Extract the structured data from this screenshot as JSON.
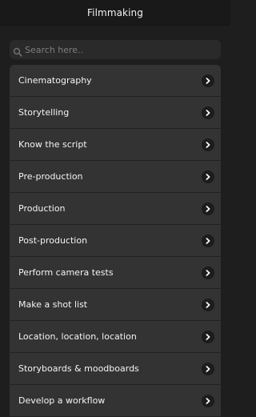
{
  "app_bar": {
    "title": "Filmmaking"
  },
  "search": {
    "placeholder": "Search here..",
    "value": "",
    "icon": "search-icon"
  },
  "list": {
    "item_icon": "chevron-right-icon",
    "items": [
      {
        "label": "Cinematography"
      },
      {
        "label": "Storytelling"
      },
      {
        "label": "Know the script"
      },
      {
        "label": "Pre-production"
      },
      {
        "label": "Production"
      },
      {
        "label": "Post-production"
      },
      {
        "label": "Perform camera tests"
      },
      {
        "label": "Make a shot list"
      },
      {
        "label": "Location, location, location"
      },
      {
        "label": "Storyboards & moodboards"
      },
      {
        "label": "Develop a workflow"
      }
    ]
  },
  "colors": {
    "background": "#1e1e1e",
    "app_bar": "#191919",
    "list_item": "#333333",
    "text": "#f4f4f4",
    "placeholder": "#7e7e7e"
  }
}
